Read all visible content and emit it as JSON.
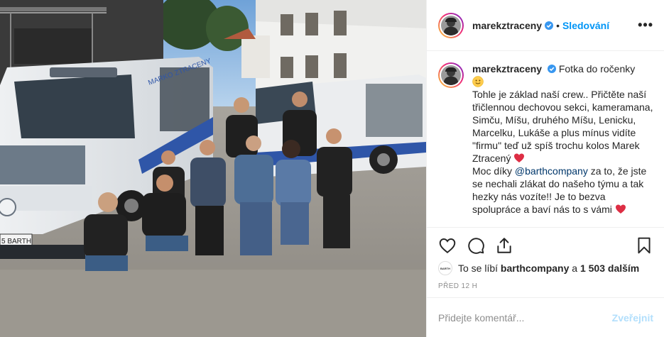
{
  "post": {
    "username": "marekztraceny",
    "follow_status": "Sledování",
    "separator": "•",
    "more_icon": "more-icon",
    "caption": {
      "username": "marekztraceny",
      "title": "Fotka do ročenky",
      "emoji": "slightly-smiling-face-emoji",
      "body_1": "Tohle je základ naší crew.. Přičtěte naší třičlennou dechovou sekci, kameramana, Simču, Míšu, druhého Míšu, Lenicku, Marcelku, Lukáše a plus mínus vidíte \"firmu\" teď už spíš trochu kolos Marek Ztracený",
      "body_2_prefix": "Moc díky ",
      "mention": "@barthcompany",
      "body_2_suffix": " za to, že jste se nechali zlákat do našeho týmu a tak hezky nás vozíte!! Je to bezva spolupráce a baví nás to s vámi"
    },
    "likes": {
      "avatar_label": "BARTH",
      "prefix": "To se líbí ",
      "user": "barthcompany",
      "suffix": " a ",
      "count": "1 503 dalším"
    },
    "timestamp": "Před 12 h",
    "comment": {
      "placeholder": "Přidejte komentář...",
      "submit_label": "Zveřejnit"
    },
    "photo": {
      "van_plate": "5 BARTH",
      "van_brand_text": "MARKO ZTRACENY"
    },
    "colors": {
      "accent": "#0095f6",
      "heart": "#ed4956",
      "verified": "#3897f0",
      "secondary_text": "#8e8e8e"
    }
  }
}
